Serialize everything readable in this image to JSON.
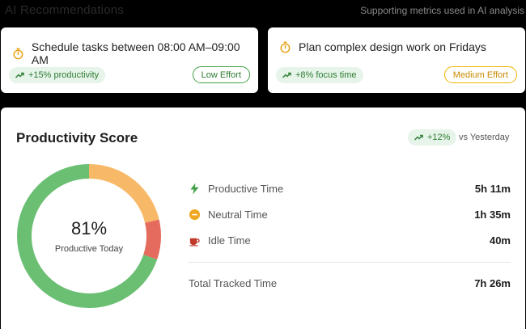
{
  "header": {
    "title": "AI Recommendations",
    "subtitle": "Supporting metrics used in AI analysis"
  },
  "recommendations": [
    {
      "icon": "stopwatch-icon",
      "title": "Schedule tasks between 08:00 AM–09:00 AM",
      "metric": "+15% productivity",
      "effort": "Low Effort",
      "effort_color": "#43a047"
    },
    {
      "icon": "stopwatch-icon",
      "title": "Plan complex design work on Fridays",
      "metric": "+8% focus time",
      "effort": "Medium Effort",
      "effort_color": "#f0b400"
    }
  ],
  "productivity": {
    "title": "Productivity Score",
    "delta": "+12%",
    "delta_label": "vs Yesterday",
    "score": "81%",
    "score_label": "Productive Today",
    "breakdown": [
      {
        "icon": "lightning-icon",
        "label": "Productive Time",
        "value": "5h 11m",
        "color": "#6bbf73",
        "minutes": 311
      },
      {
        "icon": "neutral-icon",
        "label": "Neutral Time",
        "value": "1h 35m",
        "color": "#f7b968",
        "minutes": 95
      },
      {
        "icon": "coffee-cup-icon",
        "label": "Idle Time",
        "value": "40m",
        "color": "#e46b5e",
        "minutes": 40
      }
    ],
    "total_label": "Total Tracked Time",
    "total_value": "7h 26m"
  },
  "colors": {
    "accent_green": "#2e7d32",
    "pill_green_bg": "#e7f4ea",
    "icon_orange": "#e8a317"
  }
}
